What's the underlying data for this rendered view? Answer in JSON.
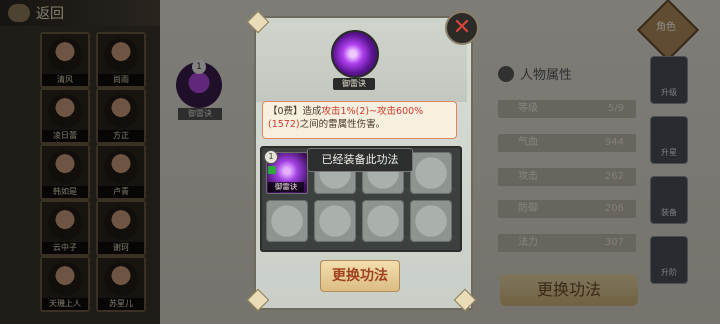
{
  "nav": {
    "back_label": "返回"
  },
  "roster": [
    {
      "name": "清风"
    },
    {
      "name": "尚雨"
    },
    {
      "name": "凌日蕾"
    },
    {
      "name": "方正"
    },
    {
      "name": "韩如是"
    },
    {
      "name": "卢青"
    },
    {
      "name": "云中子"
    },
    {
      "name": "谢珂"
    },
    {
      "name": "天璣上人"
    },
    {
      "name": "苏星儿"
    }
  ],
  "character": {
    "skill_badge": "1",
    "skill_label": "御雷诀"
  },
  "attributes": {
    "title": "人物属性",
    "rows": [
      {
        "label": "等级",
        "value": "5/9"
      },
      {
        "label": "气血",
        "value": "944"
      },
      {
        "label": "攻击",
        "value": "262"
      },
      {
        "label": "防御",
        "value": "206"
      },
      {
        "label": "法力",
        "value": "307"
      }
    ],
    "change_button": "更换功法"
  },
  "side_tabs": {
    "role": "角色",
    "items": [
      "升级",
      "升星",
      "装备",
      "升阶"
    ]
  },
  "modal": {
    "close_icon": "close-icon",
    "skill_name": "御雷诀",
    "description": {
      "prefix": "【0费】造成",
      "hl1": "攻击1%(2)~攻击600%(1572)",
      "suffix": "之间的雷属性伤害。"
    },
    "slots": {
      "equipped": {
        "badge": "1",
        "name": "御雷诀"
      },
      "tooltip": "已经装备此功法"
    },
    "change_button": "更换功法"
  }
}
